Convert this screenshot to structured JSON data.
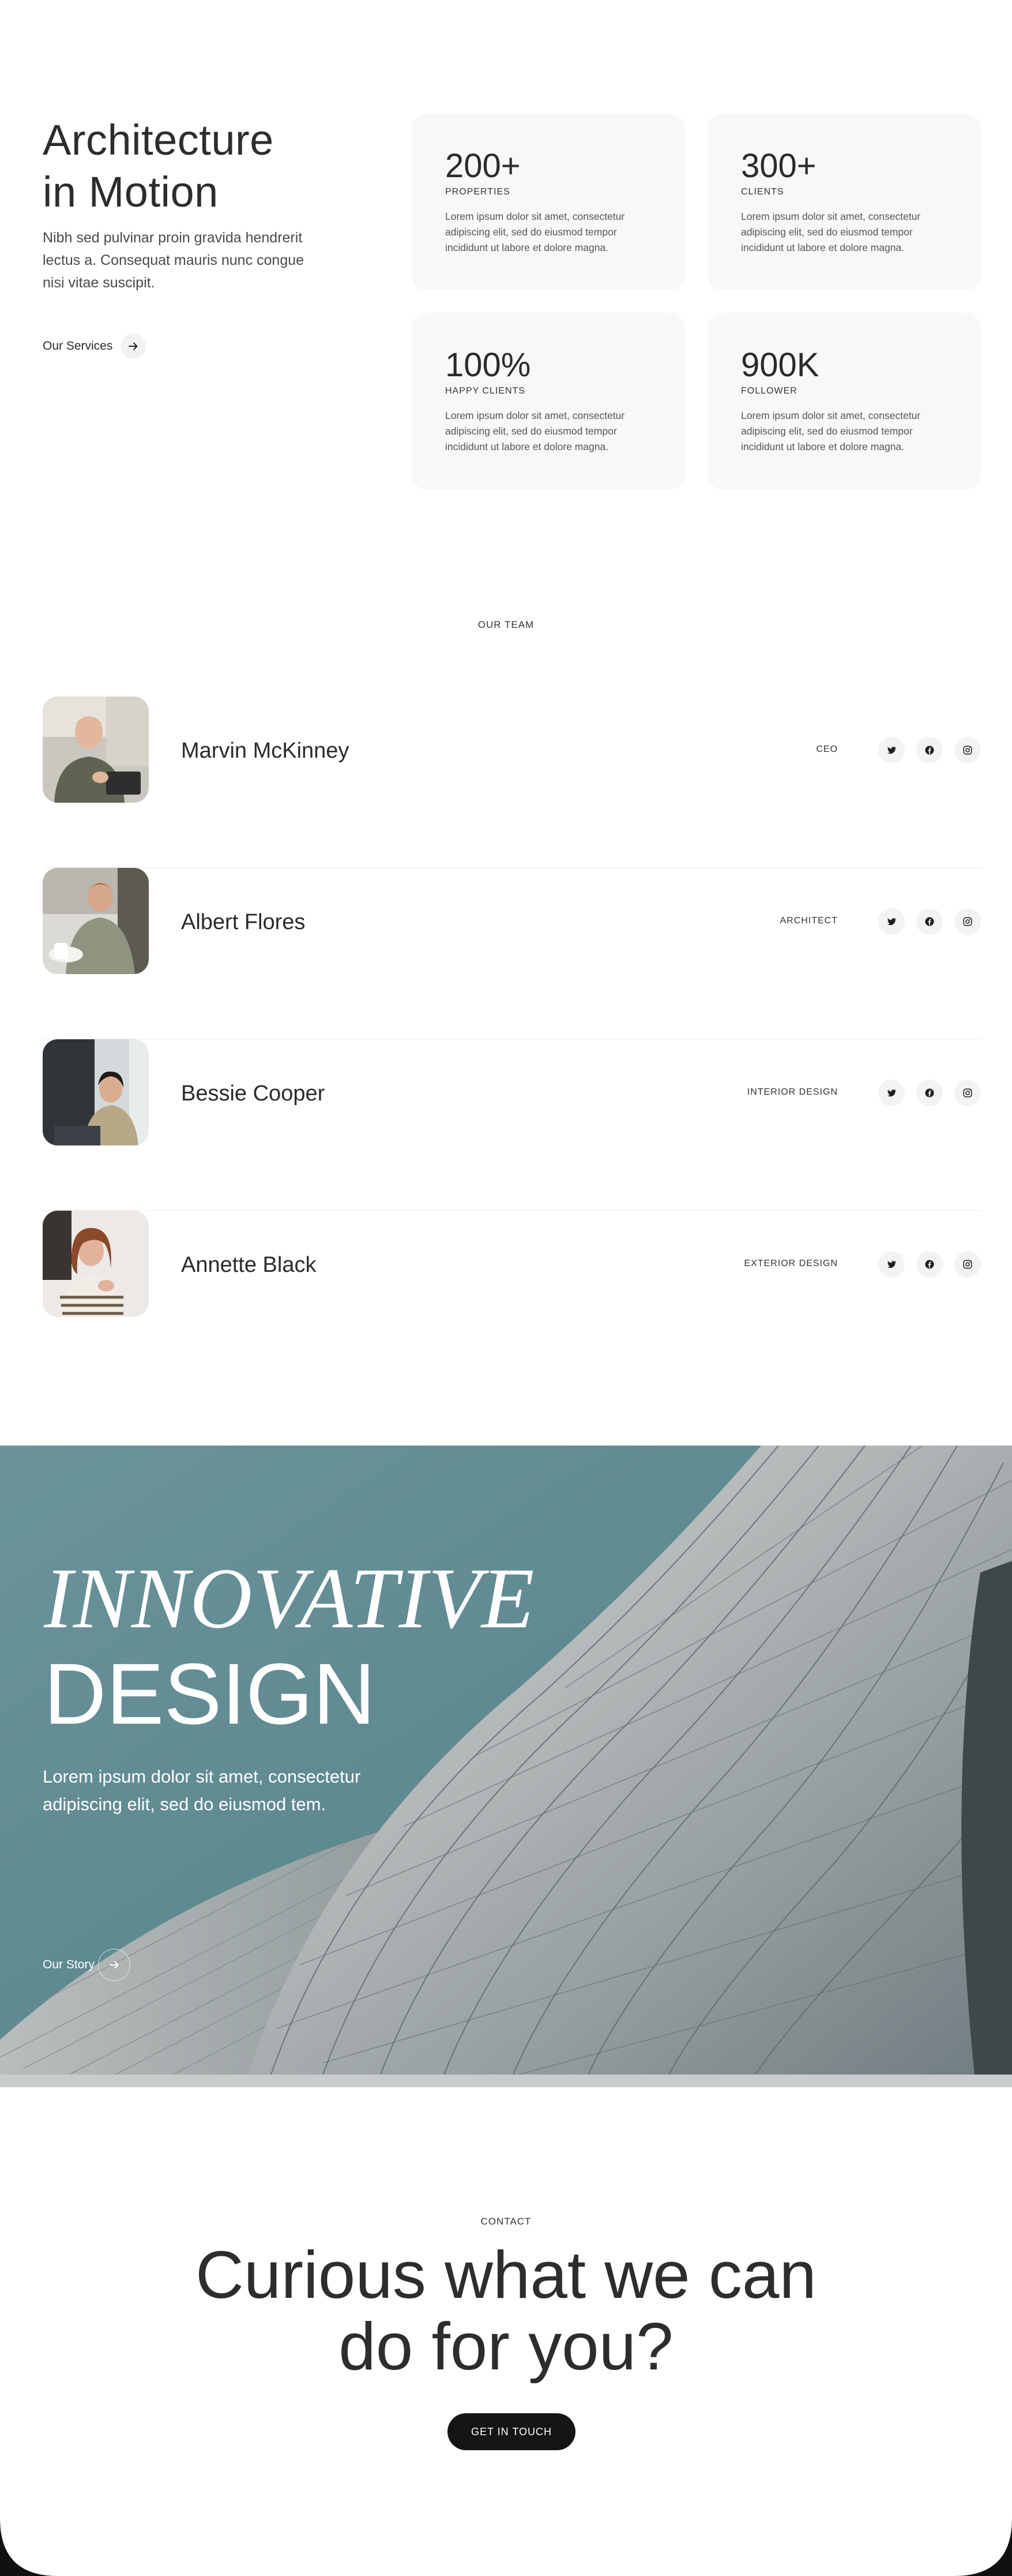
{
  "intro": {
    "title_line1": "Architecture",
    "title_line2": "in Motion",
    "text": "Nibh sed pulvinar proin gravida hendrerit lectus a. Consequat mauris nunc congue nisi vitae suscipit.",
    "services_link": "Our Services",
    "services_icon": "arrow-right-icon"
  },
  "stats": [
    {
      "number": "200+",
      "label": "PROPERTIES",
      "description": "Lorem ipsum dolor sit amet, consectetur adipiscing elit, sed do eiusmod tempor incididunt ut labore et dolore magna."
    },
    {
      "number": "300+",
      "label": "CLIENTS",
      "description": "Lorem ipsum dolor sit amet, consectetur adipiscing elit, sed do eiusmod tempor incididunt ut labore et dolore magna."
    },
    {
      "number": "100%",
      "label": "HAPPY CLIENTS",
      "description": "Lorem ipsum dolor sit amet, consectetur adipiscing elit, sed do eiusmod tempor incididunt ut labore et dolore magna."
    },
    {
      "number": "900K",
      "label": "FOLLOWER",
      "description": "Lorem ipsum dolor sit amet, consectetur adipiscing elit, sed do eiusmod tempor incididunt ut labore et dolore magna."
    }
  ],
  "team": {
    "label": "OUR TEAM",
    "social_icons": [
      "twitter-icon",
      "facebook-icon",
      "instagram-icon"
    ],
    "members": [
      {
        "name": "Marvin McKinney",
        "role": "CEO"
      },
      {
        "name": "Albert Flores",
        "role": "ARCHITECT"
      },
      {
        "name": "Bessie Cooper",
        "role": "INTERIOR DESIGN"
      },
      {
        "name": "Annette Black",
        "role": "EXTERIOR DESIGN"
      }
    ]
  },
  "hero": {
    "italic_word": "INNOVATIVE",
    "strong_word": "DESIGN",
    "text": "Lorem ipsum dolor sit amet, consectetur adipiscing elit, sed do eiusmod tem.",
    "story_link": "Our Story",
    "story_icon": "arrow-right-icon"
  },
  "contact": {
    "label": "CONTACT",
    "title_line1": "Curious what we can",
    "title_line2": "do for you?",
    "cta_label": "GET IN TOUCH"
  },
  "colors": {
    "hero_sky": "#5f8a92",
    "card_bg": "#f8f8f8",
    "cta_bg": "#151515",
    "text": "#2b2b2b"
  }
}
